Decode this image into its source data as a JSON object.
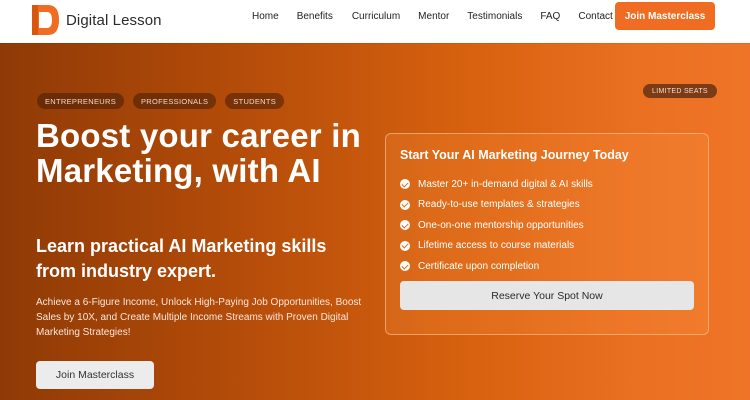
{
  "brand": {
    "name": "Digital Lesson",
    "logo_icon": "orange-d-logo-icon",
    "accent_color": "#ef6c22"
  },
  "nav": {
    "items": [
      {
        "label": "Home"
      },
      {
        "label": "Benefits"
      },
      {
        "label": "Curriculum"
      },
      {
        "label": "Mentor"
      },
      {
        "label": "Testimonials"
      },
      {
        "label": "FAQ"
      },
      {
        "label": "Contact"
      }
    ],
    "cta_label": "Join Masterclass"
  },
  "hero": {
    "tags": [
      "ENTREPRENEURS",
      "PROFESSIONALS",
      "STUDENTS"
    ],
    "headline": "Boost your career in Marketing, with AI",
    "subheadline": "Learn practical AI Marketing skills from industry expert.",
    "description": "Achieve a 6-Figure Income, Unlock High-Paying Job Opportunities, Boost Sales by 10X, and Create Multiple Income Streams with Proven Digital Marketing Strategies!",
    "cta_label": "Join Masterclass"
  },
  "card": {
    "badge": "LIMITED SEATS",
    "title": "Start Your AI Marketing Journey Today",
    "features": [
      "Master 20+ in-demand digital & AI skills",
      "Ready-to-use templates & strategies",
      "One-on-one mentorship opportunities",
      "Lifetime access to course materials",
      "Certificate upon completion"
    ],
    "feature_icon": "check-circle-icon",
    "cta_label": "Reserve Your Spot Now"
  }
}
